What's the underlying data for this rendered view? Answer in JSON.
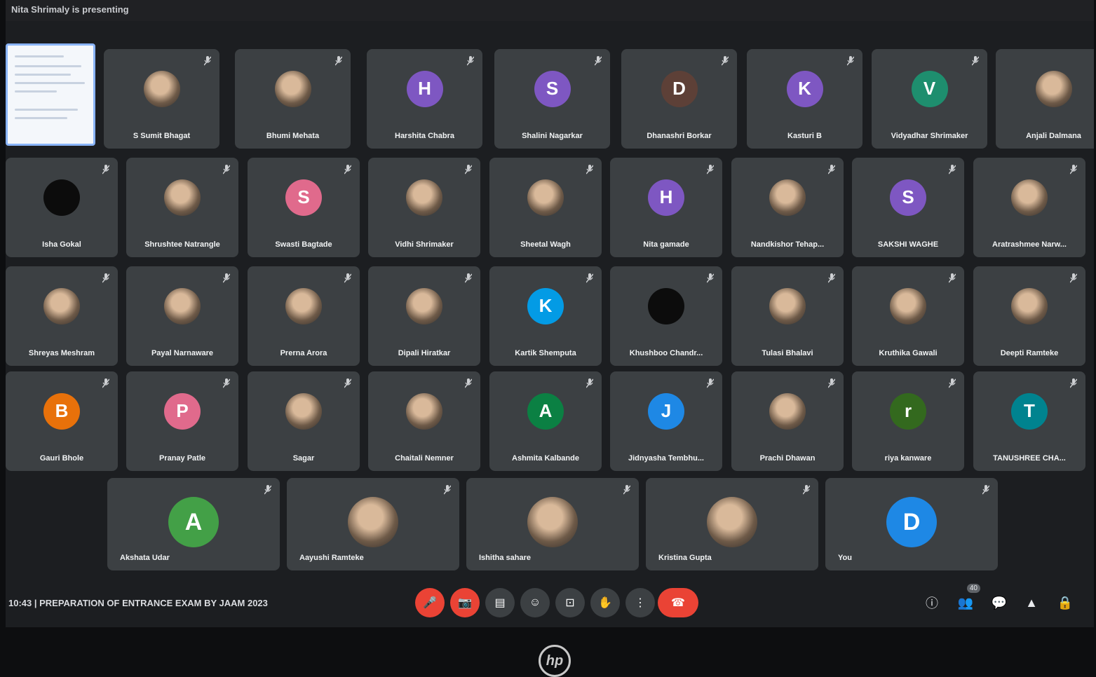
{
  "top_bar": {
    "presenting_text": "Nita Shrimaly is presenting"
  },
  "participants": [
    {
      "name": "S Sumit Bhagat",
      "avatar": "photo"
    },
    {
      "name": "Bhumi Mehata",
      "avatar": "photo"
    },
    {
      "name": "Harshita Chabra",
      "avatar": "letter",
      "letter": "H",
      "color": "#7e57c2"
    },
    {
      "name": "Shalini Nagarkar",
      "avatar": "letter",
      "letter": "S",
      "color": "#7e57c2"
    },
    {
      "name": "Dhanashri Borkar",
      "avatar": "letter",
      "letter": "D",
      "color": "#5d4037"
    },
    {
      "name": "Kasturi B",
      "avatar": "letter",
      "letter": "K",
      "color": "#7e57c2"
    },
    {
      "name": "Vidyadhar Shrimaker",
      "avatar": "letter",
      "letter": "V",
      "color": "#1e8e6e"
    },
    {
      "name": "Anjali Dalmana",
      "avatar": "photo"
    },
    {
      "name": "Isha Gokal",
      "avatar": "dark"
    },
    {
      "name": "Shrushtee Natrangle",
      "avatar": "photo"
    },
    {
      "name": "Swasti Bagtade",
      "avatar": "letter",
      "letter": "S",
      "color": "#e06a8c"
    },
    {
      "name": "Vidhi Shrimaker",
      "avatar": "photo"
    },
    {
      "name": "Sheetal Wagh",
      "avatar": "photo"
    },
    {
      "name": "Nita gamade",
      "avatar": "letter",
      "letter": "H",
      "color": "#7e57c2"
    },
    {
      "name": "Nandkishor Tehap...",
      "avatar": "photo"
    },
    {
      "name": "SAKSHI WAGHE",
      "avatar": "letter",
      "letter": "S",
      "color": "#7e57c2"
    },
    {
      "name": "Aratrashmee Narw...",
      "avatar": "photo"
    },
    {
      "name": "Shreyas Meshram",
      "avatar": "photo"
    },
    {
      "name": "Payal Narnaware",
      "avatar": "photo"
    },
    {
      "name": "Prerna Arora",
      "avatar": "photo"
    },
    {
      "name": "Dipali Hiratkar",
      "avatar": "photo"
    },
    {
      "name": "Kartik Shemputa",
      "avatar": "letter",
      "letter": "K",
      "color": "#039be5"
    },
    {
      "name": "Khushboo Chandr...",
      "avatar": "dark"
    },
    {
      "name": "Tulasi Bhalavi",
      "avatar": "photo"
    },
    {
      "name": "Kruthika Gawali",
      "avatar": "photo"
    },
    {
      "name": "Deepti Ramteke",
      "avatar": "photo"
    },
    {
      "name": "Gauri Bhole",
      "avatar": "letter",
      "letter": "B",
      "color": "#e8710a"
    },
    {
      "name": "Pranay Patle",
      "avatar": "letter",
      "letter": "P",
      "color": "#e06a8c"
    },
    {
      "name": "Sagar",
      "avatar": "photo"
    },
    {
      "name": "Chaitali Nemner",
      "avatar": "photo"
    },
    {
      "name": "Ashmita Kalbande",
      "avatar": "letter",
      "letter": "A",
      "color": "#0b8043"
    },
    {
      "name": "Jidnyasha Tembhu...",
      "avatar": "letter",
      "letter": "J",
      "color": "#1e88e5"
    },
    {
      "name": "Prachi Dhawan",
      "avatar": "photo"
    },
    {
      "name": "riya kanware",
      "avatar": "letter",
      "letter": "r",
      "color": "#33691e"
    },
    {
      "name": "TANUSHREE CHA...",
      "avatar": "letter",
      "letter": "T",
      "color": "#00838f"
    },
    {
      "name": "Akshata Udar",
      "avatar": "letter",
      "letter": "A",
      "color": "#43a047"
    },
    {
      "name": "Aayushi Ramteke",
      "avatar": "photo"
    },
    {
      "name": "Ishitha sahare",
      "avatar": "photo"
    },
    {
      "name": "Kristina Gupta",
      "avatar": "photo"
    },
    {
      "name": "You",
      "avatar": "letter",
      "letter": "D",
      "color": "#1e88e5"
    }
  ],
  "bottom_bar": {
    "meeting_info": "10:43 | PREPARATION OF ENTRANCE EXAM BY JAAM 2023",
    "controls": [
      {
        "name": "mic-toggle-button",
        "icon": "mic-off-icon",
        "glyph": "🎤",
        "color": "#ea4335"
      },
      {
        "name": "camera-toggle-button",
        "icon": "camera-off-icon",
        "glyph": "📷",
        "color": "#ea4335"
      },
      {
        "name": "captions-button",
        "icon": "captions-icon",
        "glyph": "▤",
        "color": "#3c4043"
      },
      {
        "name": "reactions-button",
        "icon": "emoji-icon",
        "glyph": "☺",
        "color": "#3c4043"
      },
      {
        "name": "present-button",
        "icon": "present-icon",
        "glyph": "⊡",
        "color": "#3c4043"
      },
      {
        "name": "raise-hand-button",
        "icon": "hand-icon",
        "glyph": "✋",
        "color": "#3c4043"
      },
      {
        "name": "more-options-button",
        "icon": "more-icon",
        "glyph": "⋮",
        "color": "#3c4043"
      }
    ],
    "leave_glyph": "☎",
    "right_controls": [
      {
        "name": "info-button",
        "icon": "info-icon",
        "glyph": "ⓘ"
      },
      {
        "name": "people-button",
        "icon": "people-icon",
        "glyph": "👥"
      },
      {
        "name": "chat-button",
        "icon": "chat-icon",
        "glyph": "💬"
      },
      {
        "name": "activities-button",
        "icon": "activities-icon",
        "glyph": "▲"
      },
      {
        "name": "host-controls-button",
        "icon": "lock-icon",
        "glyph": "🔒"
      }
    ],
    "people_badge": "40"
  },
  "bezel": {
    "logo_text": "hp"
  }
}
